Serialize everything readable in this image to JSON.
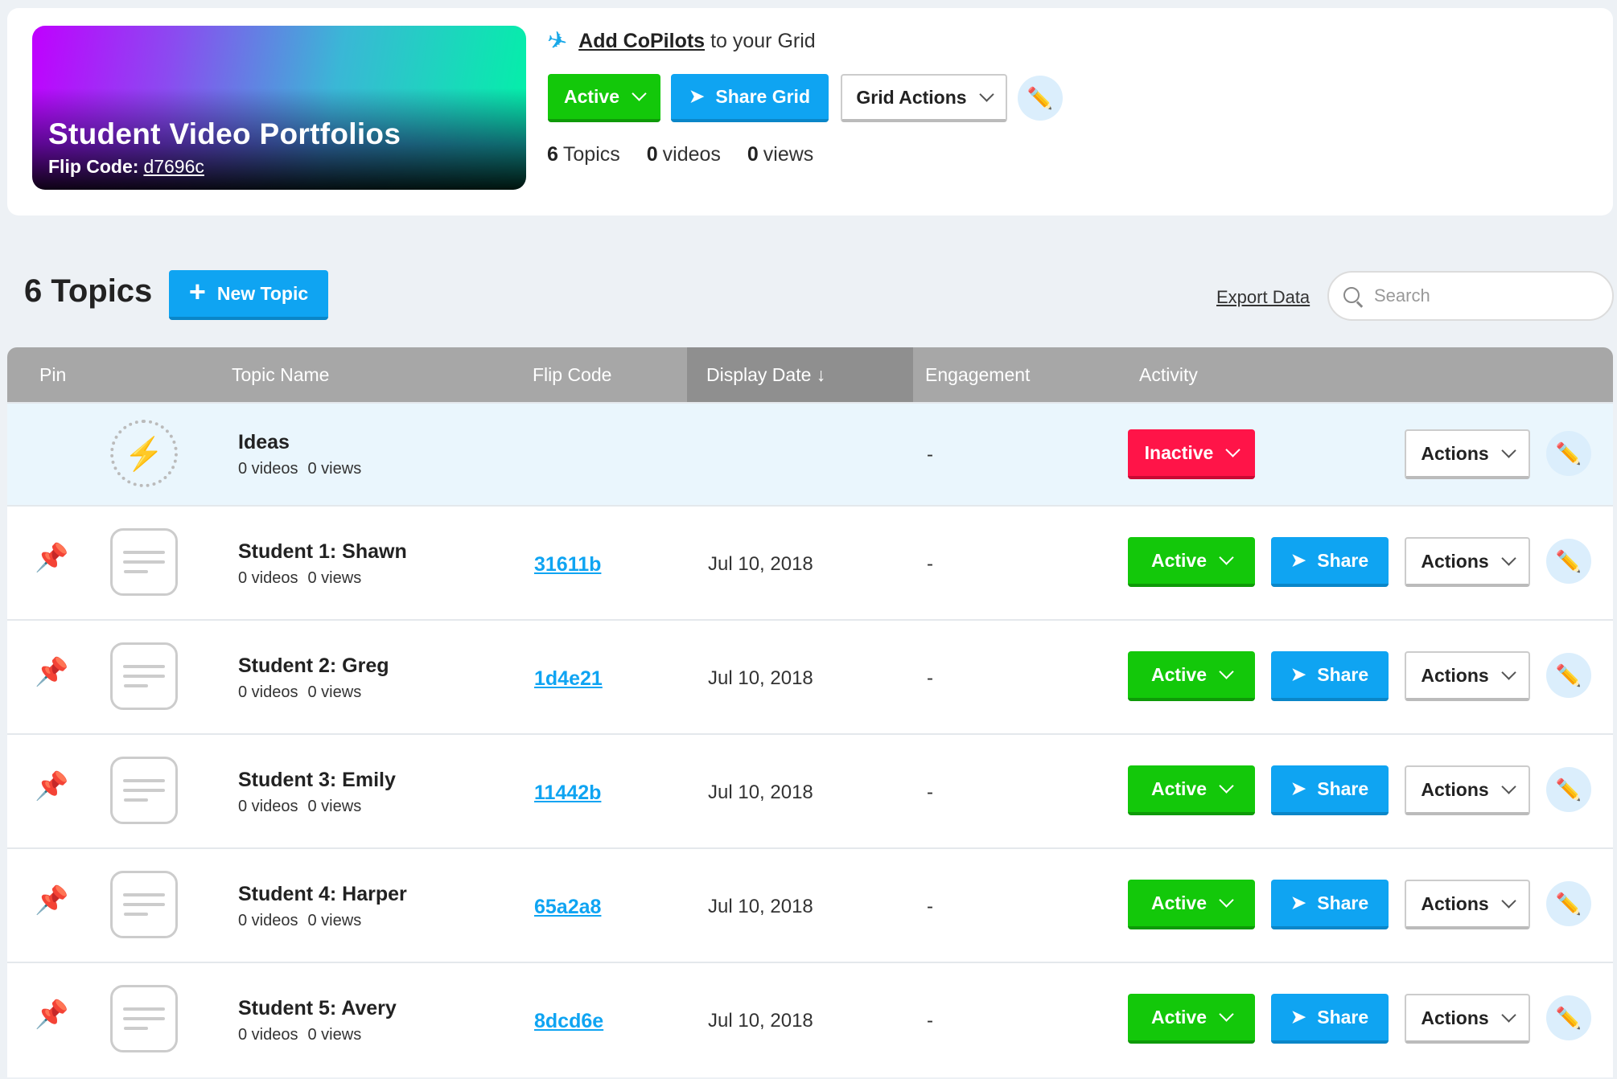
{
  "grid": {
    "title": "Student Video Portfolios",
    "flip_code_label": "Flip Code:",
    "flip_code": "d7696c",
    "copilots_link": "Add CoPilots",
    "copilots_rest": "to your Grid",
    "status_label": "Active",
    "share_label": "Share Grid",
    "actions_label": "Grid Actions",
    "stats": {
      "topics_count": "6",
      "topics_label": "Topics",
      "videos_count": "0",
      "videos_label": "videos",
      "views_count": "0",
      "views_label": "views"
    }
  },
  "topics_section": {
    "title": "6 Topics",
    "new_topic_label": "New Topic",
    "export_label": "Export Data",
    "search_placeholder": "Search"
  },
  "table": {
    "headers": {
      "pin": "Pin",
      "topic_name": "Topic Name",
      "flip_code": "Flip Code",
      "display_date": "Display Date ↓",
      "engagement": "Engagement",
      "activity": "Activity"
    },
    "ideas": {
      "name": "Ideas",
      "videos": "0 videos",
      "views": "0 views",
      "engagement": "-",
      "status": "Inactive",
      "actions_label": "Actions"
    },
    "rows": [
      {
        "name": "Student 1: Shawn",
        "videos": "0 videos",
        "views": "0 views",
        "code": "31611b",
        "date": "Jul 10, 2018",
        "engagement": "-",
        "status": "Active",
        "share": "Share",
        "actions": "Actions"
      },
      {
        "name": "Student 2: Greg",
        "videos": "0 videos",
        "views": "0 views",
        "code": "1d4e21",
        "date": "Jul 10, 2018",
        "engagement": "-",
        "status": "Active",
        "share": "Share",
        "actions": "Actions"
      },
      {
        "name": "Student 3: Emily",
        "videos": "0 videos",
        "views": "0 views",
        "code": "11442b",
        "date": "Jul 10, 2018",
        "engagement": "-",
        "status": "Active",
        "share": "Share",
        "actions": "Actions"
      },
      {
        "name": "Student 4: Harper",
        "videos": "0 videos",
        "views": "0 views",
        "code": "65a2a8",
        "date": "Jul 10, 2018",
        "engagement": "-",
        "status": "Active",
        "share": "Share",
        "actions": "Actions"
      },
      {
        "name": "Student 5: Avery",
        "videos": "0 videos",
        "views": "0 views",
        "code": "8dcd6e",
        "date": "Jul 10, 2018",
        "engagement": "-",
        "status": "Active",
        "share": "Share",
        "actions": "Actions"
      }
    ]
  },
  "colors": {
    "active_green": "#13c80a",
    "share_blue": "#0fa4f2",
    "inactive_red": "#ff1448",
    "header_gray": "#a7a7a7",
    "link_blue": "#0fa4f2"
  },
  "icons": {
    "copilot": "paper-plane-icon",
    "share": "send-icon",
    "edit": "pencil-icon",
    "pin": "pushpin-icon",
    "topic": "text-lines-icon",
    "ideas": "lightning-icon",
    "search": "search-icon",
    "add": "plus-icon"
  }
}
